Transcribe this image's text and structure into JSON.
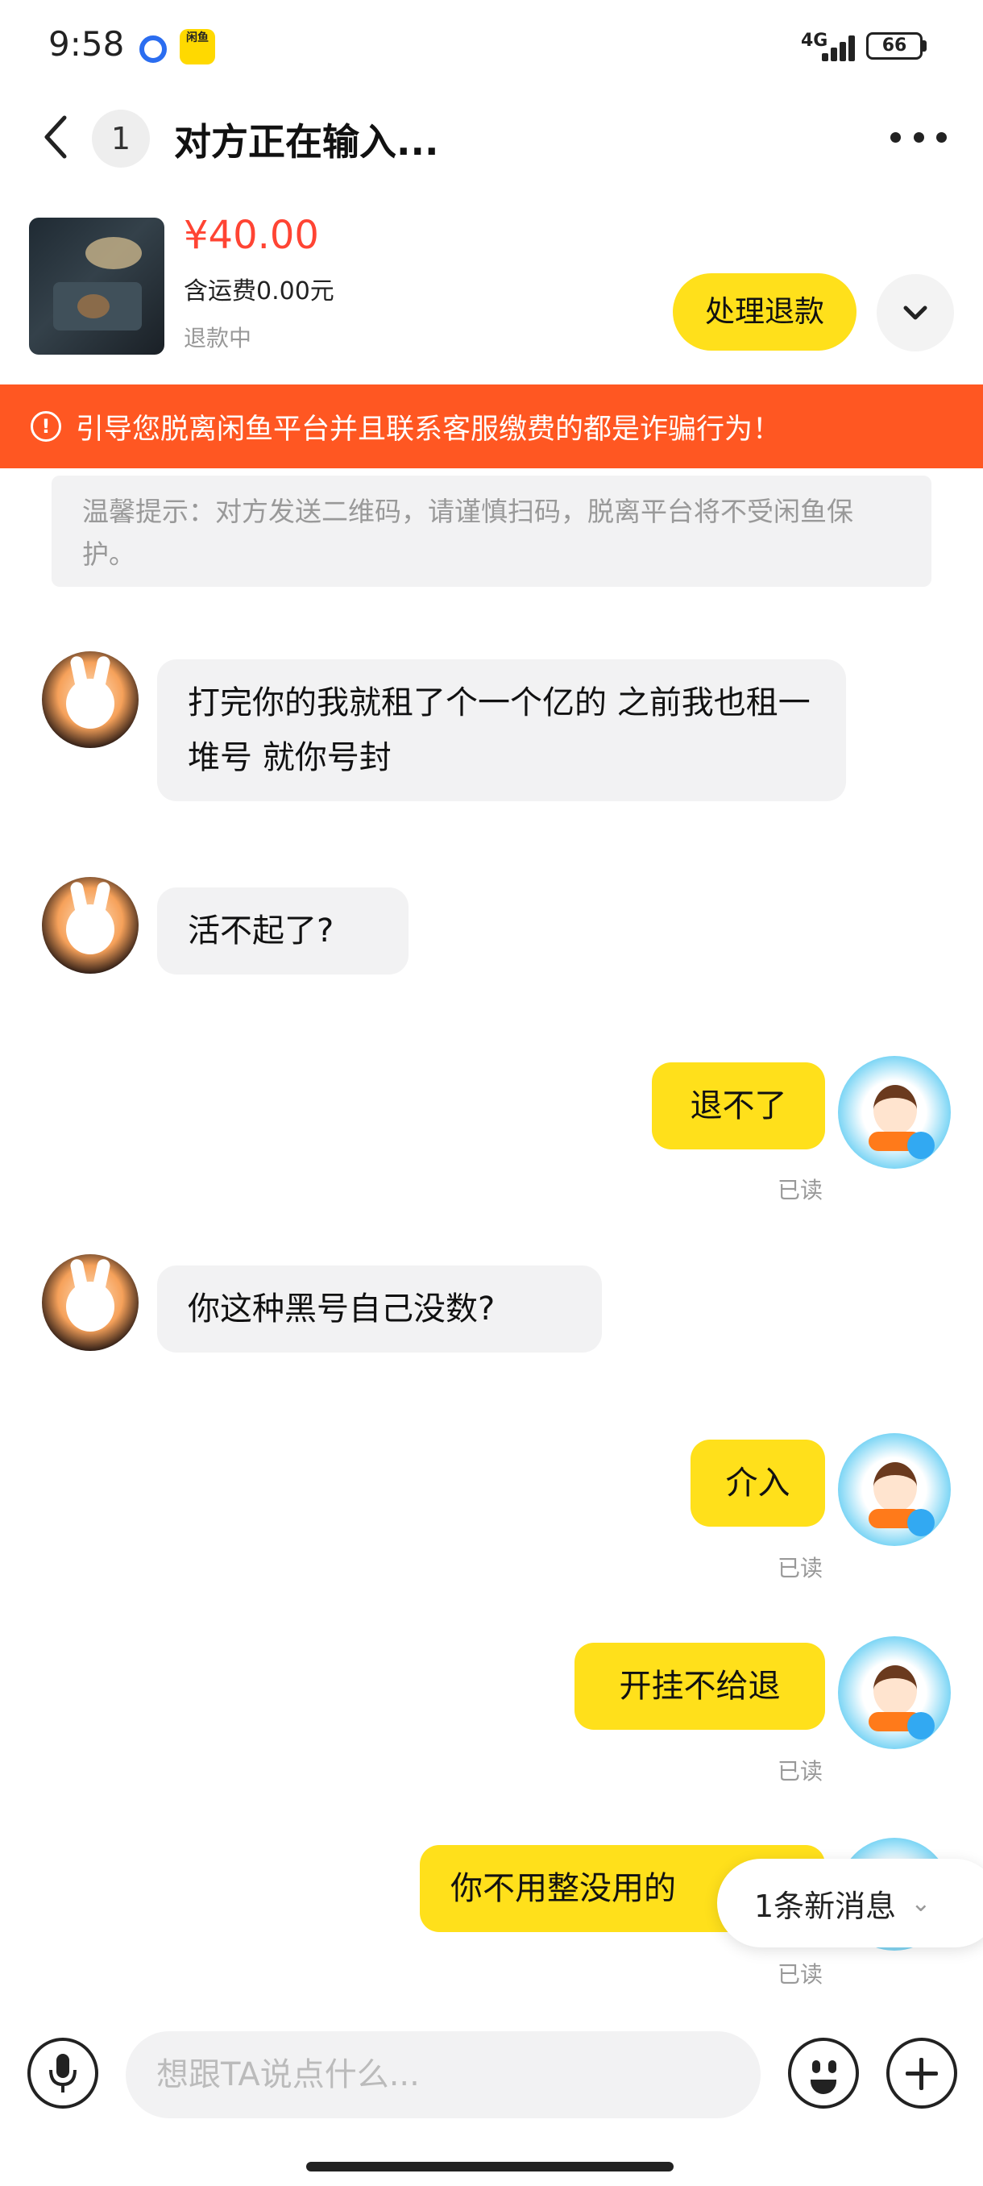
{
  "status_bar": {
    "time": "9:58",
    "network": "4G",
    "battery": "66",
    "app_badge": "闲鱼"
  },
  "header": {
    "unread_count": "1",
    "title": "对方正在输入..."
  },
  "product": {
    "price": "¥40.00",
    "shipping": "含运费0.00元",
    "status": "退款中",
    "action_label": "处理退款"
  },
  "warning": {
    "text": "引导您脱离闲鱼平台并且联系客服缴费的都是诈骗行为！"
  },
  "tip": {
    "text": "温馨提示：对方发送二维码，请谨慎扫码，脱离平台将不受闲鱼保护。"
  },
  "messages": [
    {
      "side": "in",
      "text": "打完你的我就租了个一个亿的 之前我也租一堆号 就你号封"
    },
    {
      "side": "in",
      "text": "活不起了?"
    },
    {
      "side": "out",
      "text": "退不了",
      "read": "已读"
    },
    {
      "side": "in",
      "text": "你这种黑号自己没数?"
    },
    {
      "side": "out",
      "text": "介入",
      "read": "已读"
    },
    {
      "side": "out",
      "text": "开挂不给退",
      "read": "已读"
    },
    {
      "side": "out",
      "text": "你不用整没用的",
      "read": "已读"
    }
  ],
  "new_message_pill": "1条新消息",
  "composer": {
    "placeholder": "想跟TA说点什么..."
  },
  "icons": {
    "back": "chevron-left-icon",
    "more": "more-dots-icon",
    "expand": "chevron-down-icon",
    "warning": "alert-circle-icon",
    "voice": "microphone-icon",
    "emoji": "emoji-icon",
    "plus": "plus-icon"
  },
  "colors": {
    "accent": "#ffe01b",
    "price": "#ff4433",
    "warning_bg": "#ff5722"
  }
}
